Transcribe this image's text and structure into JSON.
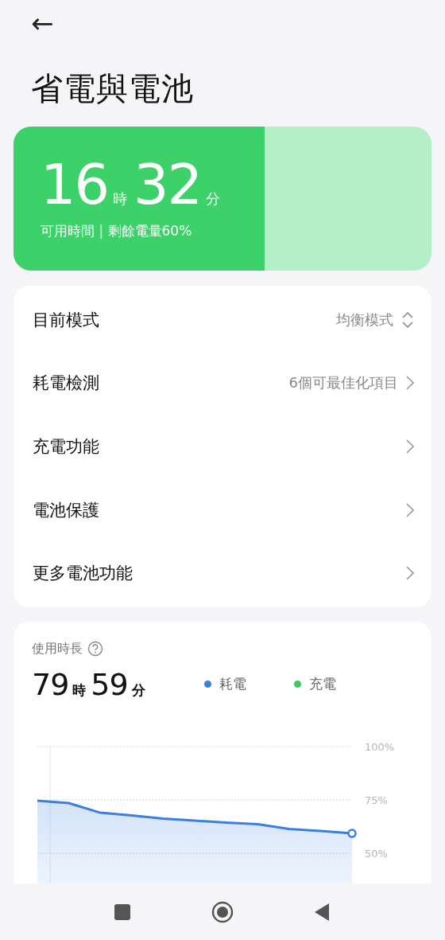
{
  "header": {
    "back": "←",
    "title": "省電與電池"
  },
  "battery": {
    "hours": "16",
    "hours_unit": "時",
    "minutes": "32",
    "minutes_unit": "分",
    "caption": "可用時間 | 剩餘電量60%",
    "level": 0.6
  },
  "settings": [
    {
      "kind": "select",
      "label": "目前模式",
      "value": "均衡模式"
    },
    {
      "kind": "link",
      "label": "耗電檢測",
      "value": "6個可最佳化項目"
    },
    {
      "kind": "link",
      "label": "充電功能"
    },
    {
      "kind": "link",
      "label": "電池保護"
    },
    {
      "kind": "link",
      "label": "更多電池功能"
    }
  ],
  "usage": {
    "title": "使用時長",
    "hours": "79",
    "hours_unit": "時",
    "minutes": "59",
    "minutes_unit": "分",
    "legend": [
      {
        "label": "耗電",
        "color": "#3b7fe0"
      },
      {
        "label": "充電",
        "color": "#3ec865"
      }
    ],
    "chart_data": {
      "type": "area",
      "ylim": [
        33,
        100
      ],
      "yticks": [
        {
          "value": 100,
          "label": "100%"
        },
        {
          "value": 75,
          "label": "75%"
        },
        {
          "value": 50,
          "label": "50%"
        }
      ],
      "series": [
        {
          "color": "#3b7fe0",
          "values": [
            74.6,
            73.5,
            69.0,
            67.7,
            66.2,
            65.3,
            64.4,
            63.6,
            61.4,
            60.4,
            59.3
          ]
        }
      ]
    }
  }
}
